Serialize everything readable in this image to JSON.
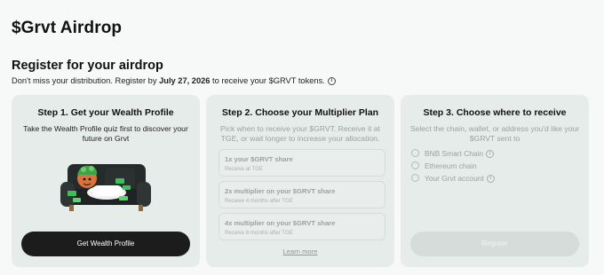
{
  "page": {
    "title": "$Grvt Airdrop",
    "section_title": "Register for your airdrop",
    "subtitle_prefix": "Don't miss your distribution. Register by ",
    "subtitle_date": "July 27, 2026",
    "subtitle_suffix": " to receive your $GRVT tokens."
  },
  "step1": {
    "title": "Step 1. Get your Wealth Profile",
    "desc": "Take the Wealth Profile quiz first to discover your future on Grvt",
    "button": "Get Wealth Profile"
  },
  "step2": {
    "title": "Step 2. Choose your Multiplier Plan",
    "desc": "Pick when to receive your $GRVT. Receive it at TGE, or wait longer to increase your allocation.",
    "plans": [
      {
        "title": "1x your $GRVT share",
        "sub": "Receive at TGE"
      },
      {
        "title": "2x multiplier on your $GRVT share",
        "sub": "Receive 4 months after TGE"
      },
      {
        "title": "4x multiplier on your $GRVT share",
        "sub": "Receive 8 months after TGE"
      }
    ],
    "learn_more": "Learn more"
  },
  "step3": {
    "title": "Step 3. Choose where to receive",
    "desc": "Select the chain, wallet, or address you'd like your $GRVT sent to",
    "options": [
      "BNB Smart Chain",
      "Ethereum chain",
      "Your Grvt account"
    ],
    "button": "Register"
  },
  "icons": {
    "info": "info-icon",
    "radio": "radio-icon",
    "illustration": "couch-character-illustration"
  }
}
